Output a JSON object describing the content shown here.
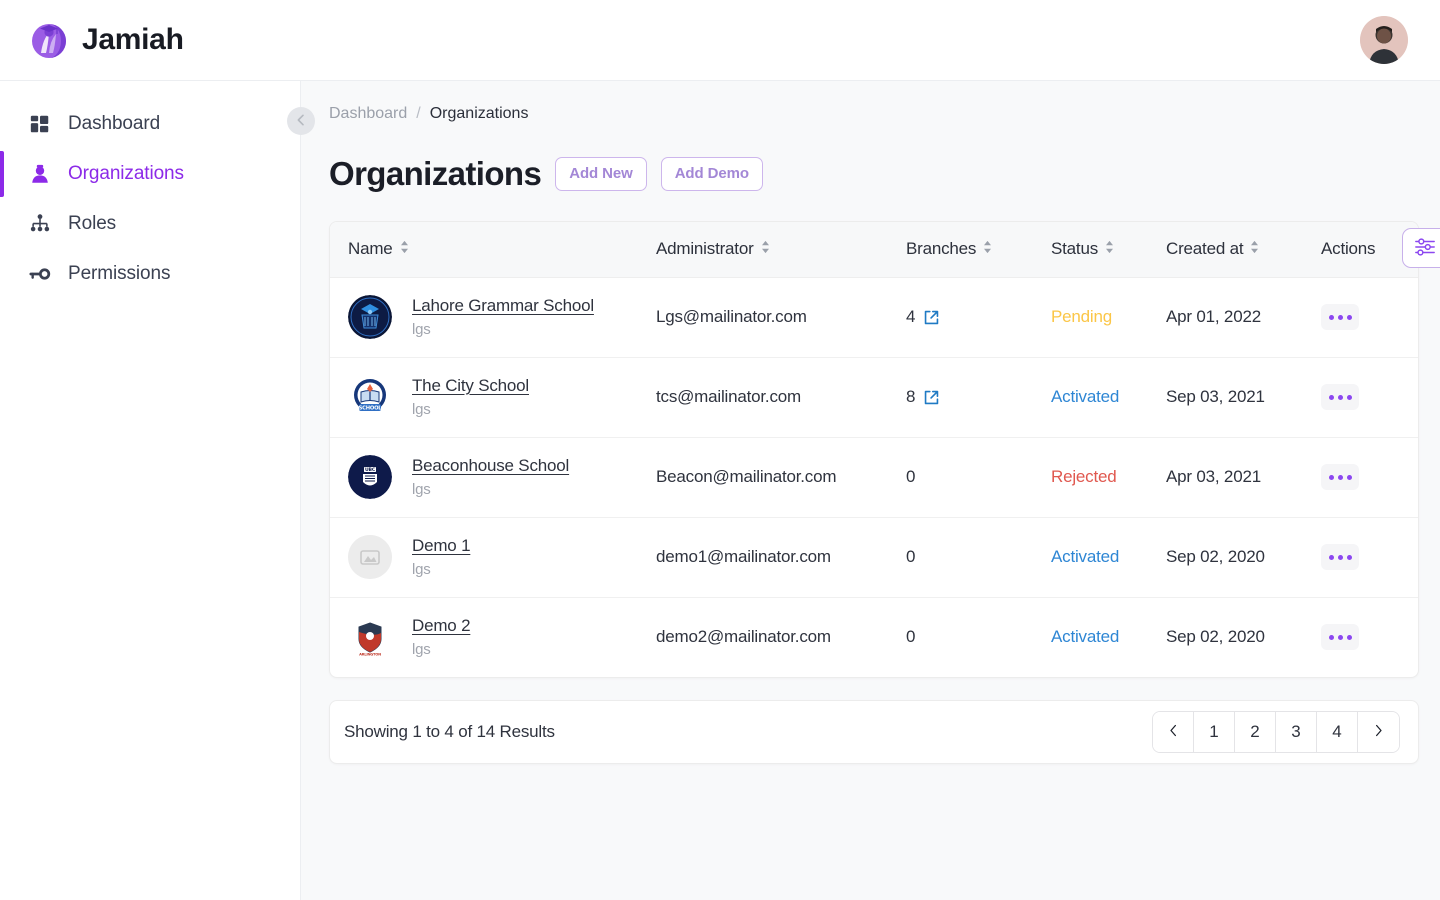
{
  "brand": {
    "name": "Jamiah",
    "logo_icon": "jamiah-graduate-logo",
    "accent": "#8c2ae8"
  },
  "topbar": {
    "avatar_icon": "user-avatar"
  },
  "sidebar": {
    "collapse_icon": "chevron-left-icon",
    "items": [
      {
        "label": "Dashboard",
        "icon": "grid-dashboard-icon",
        "active": false
      },
      {
        "label": "Organizations",
        "icon": "user-person-icon",
        "active": true
      },
      {
        "label": "Roles",
        "icon": "hierarchy-org-chart-icon",
        "active": false
      },
      {
        "label": "Permissions",
        "icon": "key-icon",
        "active": false
      }
    ]
  },
  "breadcrumb": {
    "parent": "Dashboard",
    "separator": "/",
    "current": "Organizations"
  },
  "page": {
    "title": "Organizations",
    "add_new_label": "Add New",
    "add_demo_label": "Add Demo",
    "filter_icon": "sliders-filter-icon"
  },
  "table": {
    "columns": [
      {
        "label": "Name",
        "sortable": true
      },
      {
        "label": "Administrator",
        "sortable": true
      },
      {
        "label": "Branches",
        "sortable": true
      },
      {
        "label": "Status",
        "sortable": true
      },
      {
        "label": "Created at",
        "sortable": true
      },
      {
        "label": "Actions",
        "sortable": false
      }
    ],
    "rows": [
      {
        "logo_icon": "lahore-grammar-school-logo",
        "name": "Lahore Grammar School",
        "sub": "lgs",
        "administrator": "Lgs@mailinator.com",
        "branches": "4",
        "has_branch_link": true,
        "status": "Pending",
        "status_color": "#fbc647",
        "created_at": "Apr 01, 2022"
      },
      {
        "logo_icon": "the-city-school-logo",
        "name": "The City School",
        "sub": "lgs",
        "administrator": "tcs@mailinator.com",
        "branches": "8",
        "has_branch_link": true,
        "status": "Activated",
        "status_color": "#2e86d4",
        "created_at": "Sep 03, 2021"
      },
      {
        "logo_icon": "beaconhouse-school-logo",
        "name": "Beaconhouse School",
        "sub": "lgs",
        "administrator": "Beacon@mailinator.com",
        "branches": "0",
        "has_branch_link": false,
        "status": "Rejected",
        "status_color": "#e0584f",
        "created_at": "Apr 03, 2021"
      },
      {
        "logo_icon": "image-placeholder-icon",
        "name": "Demo 1",
        "sub": "lgs",
        "administrator": "demo1@mailinator.com",
        "branches": "0",
        "has_branch_link": false,
        "status": "Activated",
        "status_color": "#2e86d4",
        "created_at": "Sep 02, 2020"
      },
      {
        "logo_icon": "arlington-shield-logo",
        "name": "Demo 2",
        "sub": "lgs",
        "administrator": "demo2@mailinator.com",
        "branches": "0",
        "has_branch_link": false,
        "status": "Activated",
        "status_color": "#2e86d4",
        "created_at": "Sep 02, 2020"
      }
    ],
    "row_action_icon": "ellipsis-menu-icon",
    "branch_link_icon": "external-link-icon"
  },
  "pagination": {
    "showing_text": "Showing 1 to 4 of 14 Results",
    "prev_icon": "chevron-left-icon",
    "next_icon": "chevron-right-icon",
    "pages": [
      "1",
      "2",
      "3",
      "4"
    ]
  }
}
